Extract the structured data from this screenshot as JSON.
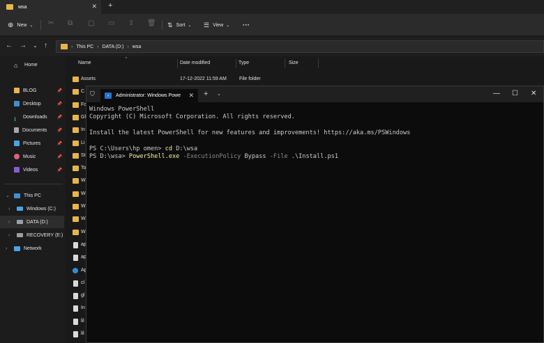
{
  "explorer": {
    "tab_title": "wsa",
    "toolbar": {
      "new_label": "New",
      "sort_label": "Sort",
      "view_label": "View",
      "more_label": "···"
    },
    "breadcrumb": [
      "This PC",
      "DATA (D:)",
      "wsa"
    ],
    "sidebar": {
      "home": "Home",
      "quick_access": [
        "BLOG",
        "Desktop",
        "Downloads",
        "Documents",
        "Pictures",
        "Music",
        "Videos"
      ],
      "this_pc": "This PC",
      "drives": [
        "Windows (C:)",
        "DATA (D:)",
        "RECOVERY (E:)"
      ],
      "network": "Network"
    },
    "columns": {
      "name": "Name",
      "date": "Date modified",
      "type": "Type",
      "size": "Size"
    },
    "rows": [
      {
        "name": "Assets",
        "date": "17-12-2022 11:59 AM",
        "type": "File folder",
        "icon": "folder"
      },
      {
        "name": "C",
        "icon": "folder"
      },
      {
        "name": "Fc",
        "icon": "folder"
      },
      {
        "name": "Gl",
        "icon": "folder"
      },
      {
        "name": "In",
        "icon": "folder"
      },
      {
        "name": "Li",
        "icon": "folder"
      },
      {
        "name": "St",
        "icon": "folder"
      },
      {
        "name": "To",
        "icon": "folder"
      },
      {
        "name": "W",
        "icon": "folder"
      },
      {
        "name": "W",
        "icon": "folder"
      },
      {
        "name": "W",
        "icon": "folder"
      },
      {
        "name": "W",
        "icon": "folder"
      },
      {
        "name": "W",
        "icon": "folder"
      },
      {
        "name": "ap",
        "icon": "file"
      },
      {
        "name": "ap",
        "icon": "file"
      },
      {
        "name": "Ap",
        "icon": "edge"
      },
      {
        "name": "cl",
        "icon": "file"
      },
      {
        "name": "gl",
        "icon": "file"
      },
      {
        "name": "In",
        "icon": "file"
      },
      {
        "name": "lil",
        "icon": "file"
      },
      {
        "name": "lil",
        "icon": "file"
      }
    ]
  },
  "terminal": {
    "tab_title": "Administrator: Windows Powe",
    "lines": {
      "l1": "Windows PowerShell",
      "l2": "Copyright (C) Microsoft Corporation. All rights reserved.",
      "l3": "Install the latest PowerShell for new features and improvements! https://aka.ms/PSWindows",
      "l4_prompt": "PS C:\\Users\\hp omen> ",
      "l4_cmd": "cd",
      "l4_arg": " D:\\wsa",
      "l5_prompt": "PS D:\\wsa> ",
      "l5_cmd": "PowerShell.exe",
      "l5_p1": " -ExecutionPolicy",
      "l5_v1": " Bypass",
      "l5_p2": " -File",
      "l5_v2": " .\\Install.ps1"
    }
  },
  "colors": {
    "folder": "#e8b54a",
    "terminal_bg": "#0c0c0c",
    "cmd_yellow": "#f9f1a5",
    "param_gray": "#8a8a8a"
  }
}
